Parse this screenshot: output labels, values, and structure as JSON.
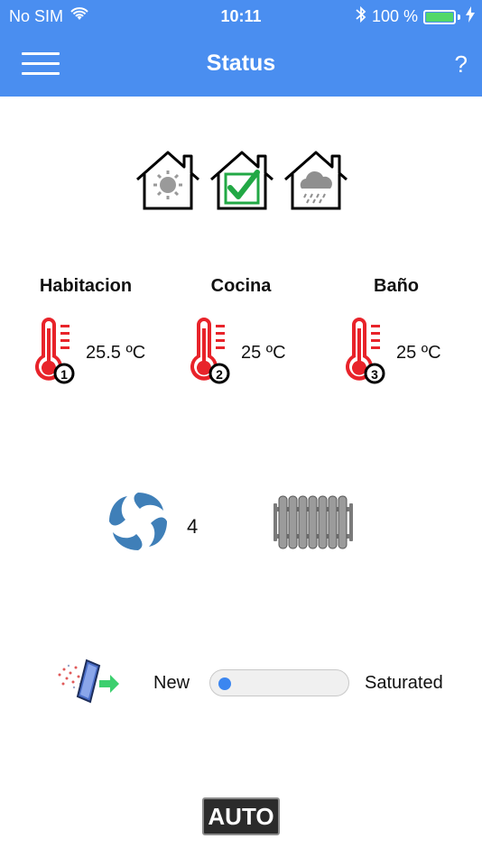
{
  "status_bar": {
    "carrier": "No SIM",
    "time": "10:11",
    "battery_percent": "100 %",
    "battery_level": 1.0
  },
  "nav": {
    "title": "Status",
    "help_label": "?",
    "bar_color": "#4a8ef0"
  },
  "mode_icons": [
    {
      "icon": "sun-house-icon"
    },
    {
      "icon": "checked-house-icon"
    },
    {
      "icon": "rain-house-icon"
    }
  ],
  "zones": [
    {
      "name": "Habitacion",
      "number": "1",
      "temperature": "25.5 ºC"
    },
    {
      "name": "Cocina",
      "number": "2",
      "temperature": "25 ºC"
    },
    {
      "name": "Baño",
      "number": "3",
      "temperature": "25 ºC"
    }
  ],
  "ventilation": {
    "fan_speed": "4"
  },
  "filter": {
    "label_new": "New",
    "label_saturated": "Saturated",
    "saturation_level": 0.05
  },
  "mode_button": {
    "label": "AUTO"
  },
  "colors": {
    "accent_blue": "#4a8ef0",
    "thermometer_red": "#e8232a",
    "check_green": "#22a845",
    "slider_knob": "#3b86f0"
  }
}
